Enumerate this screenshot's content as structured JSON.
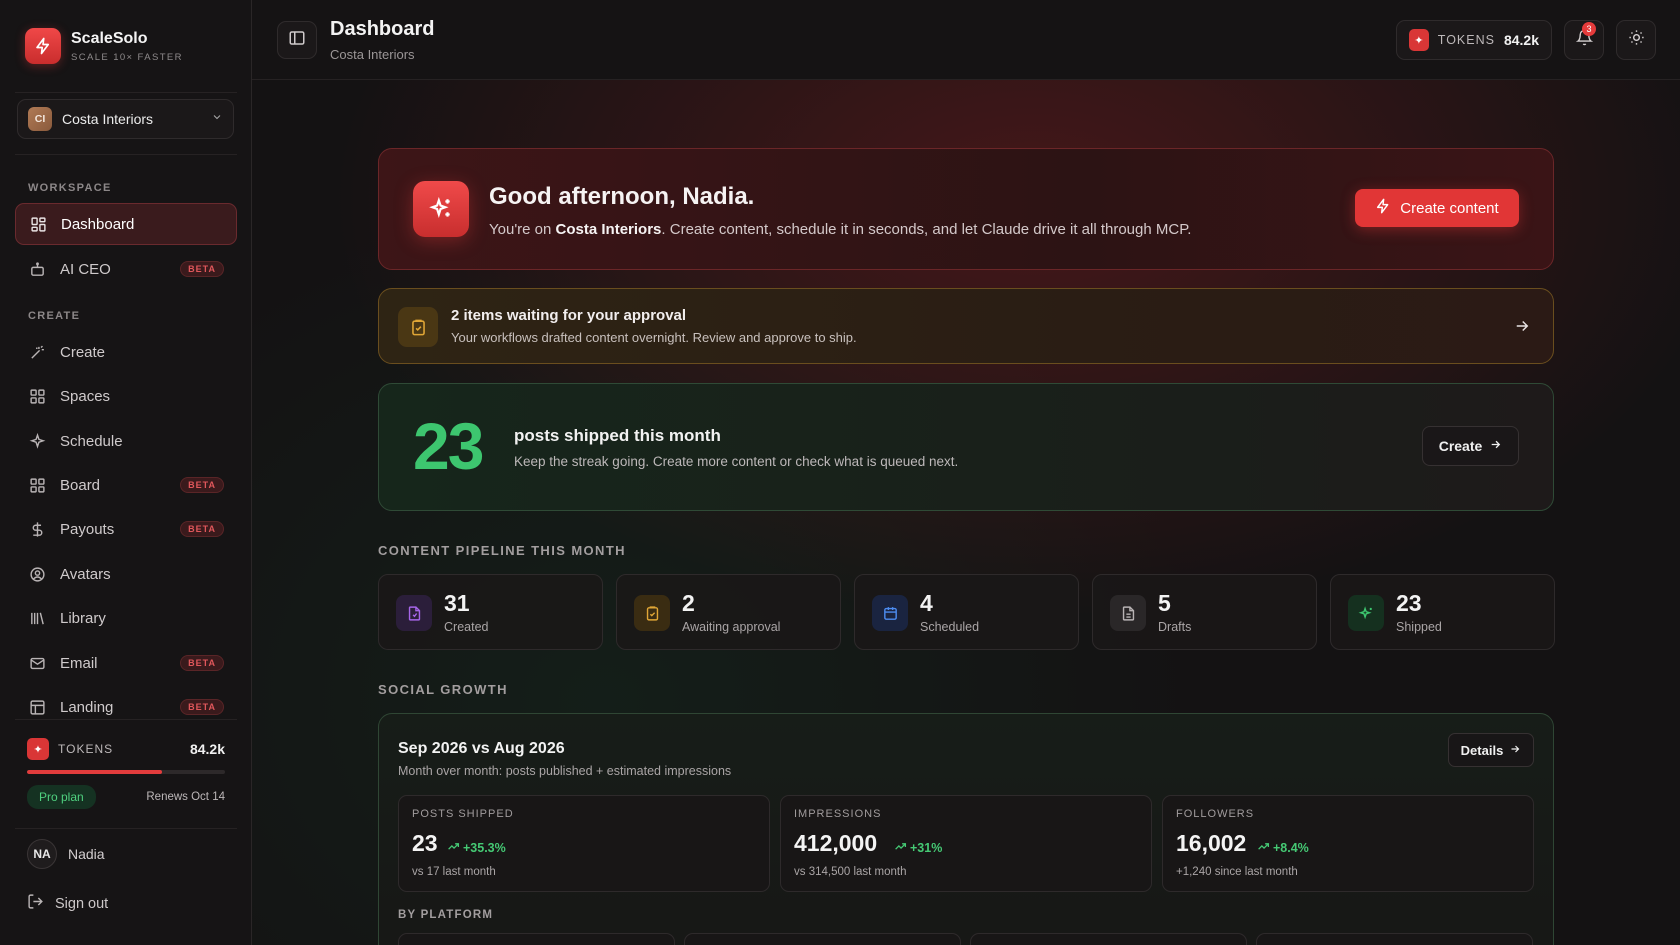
{
  "brand": {
    "name": "ScaleSolo",
    "tagline": "SCALE 10× FASTER"
  },
  "workspace_select": {
    "initials": "CI",
    "name": "Costa Interiors"
  },
  "sidebar": {
    "sections": [
      {
        "label": "WORKSPACE"
      },
      {
        "label": "CREATE"
      }
    ],
    "items": [
      {
        "label": "Dashboard",
        "icon": "grid-icon",
        "active": true
      },
      {
        "label": "AI CEO",
        "icon": "robot-icon",
        "badge": "BETA"
      },
      {
        "label": "Create",
        "icon": "wand-icon"
      },
      {
        "label": "Spaces",
        "icon": "grid-icon"
      },
      {
        "label": "Schedule",
        "icon": "sparkle-icon"
      },
      {
        "label": "Board",
        "icon": "grid-icon",
        "badge": "BETA"
      },
      {
        "label": "Payouts",
        "icon": "dollar-icon",
        "badge": "BETA"
      },
      {
        "label": "Avatars",
        "icon": "user-circle-icon"
      },
      {
        "label": "Library",
        "icon": "library-icon"
      },
      {
        "label": "Email",
        "icon": "mail-icon",
        "badge": "BETA"
      },
      {
        "label": "Landing",
        "icon": "layout-icon",
        "badge": "BETA"
      }
    ],
    "tokens": {
      "label": "TOKENS",
      "value": "84.2k",
      "usage_fraction": 0.68
    },
    "plan": {
      "label": "Pro plan",
      "renews": "Renews Oct 14"
    },
    "user": {
      "initials": "NA",
      "name": "Nadia"
    },
    "sign_out": "Sign out"
  },
  "topbar": {
    "title": "Dashboard",
    "subtitle": "Costa Interiors",
    "tokens_label": "TOKENS",
    "tokens_value": "84.2k",
    "notification_count": "3"
  },
  "hero": {
    "title": "Good afternoon, Nadia.",
    "text_prefix": "You're on ",
    "text_bold": "Costa Interiors",
    "text_suffix": ". Create content, schedule it in seconds, and let Claude drive it all through MCP.",
    "button": "Create content"
  },
  "approval": {
    "title": "2 items waiting for your approval",
    "text": "Your workflows drafted content overnight. Review and approve to ship."
  },
  "shipped": {
    "count": "23",
    "title": "posts shipped this month",
    "text": "Keep the streak going. Create more content or check what is queued next.",
    "button": "Create"
  },
  "pipeline": {
    "heading": "CONTENT PIPELINE THIS MONTH",
    "stats": [
      {
        "value": "31",
        "label": "Created",
        "icon": "file-icon",
        "color": "#a665e8",
        "bg": "#2b1e3a"
      },
      {
        "value": "2",
        "label": "Awaiting approval",
        "icon": "clipboard-icon",
        "color": "#e0a636",
        "bg": "#3a2c12"
      },
      {
        "value": "4",
        "label": "Scheduled",
        "icon": "calendar-icon",
        "color": "#4d8cf0",
        "bg": "#1a2440"
      },
      {
        "value": "5",
        "label": "Drafts",
        "icon": "document-icon",
        "color": "#b8b3b4",
        "bg": "#2a2728"
      },
      {
        "value": "23",
        "label": "Shipped",
        "icon": "sparkle-icon",
        "color": "#3dc66f",
        "bg": "#15301f"
      }
    ]
  },
  "growth": {
    "heading": "SOCIAL GROWTH",
    "title": "Sep 2026 vs Aug 2026",
    "subtitle": "Month over month: posts published + estimated impressions",
    "details_button": "Details",
    "metrics": [
      {
        "label": "POSTS SHIPPED",
        "value": "23",
        "delta": "+35.3%",
        "note": "vs 17 last month"
      },
      {
        "label": "IMPRESSIONS",
        "value": "412,000",
        "delta": "+31%",
        "note": "vs 314,500 last month"
      },
      {
        "label": "FOLLOWERS",
        "value": "16,002",
        "delta": "+8.4%",
        "note": "+1,240 since last month"
      }
    ],
    "by_platform": "BY PLATFORM"
  },
  "colors": {
    "accent": "#e13636",
    "success": "#3dc66f",
    "warning": "#e0a636"
  }
}
